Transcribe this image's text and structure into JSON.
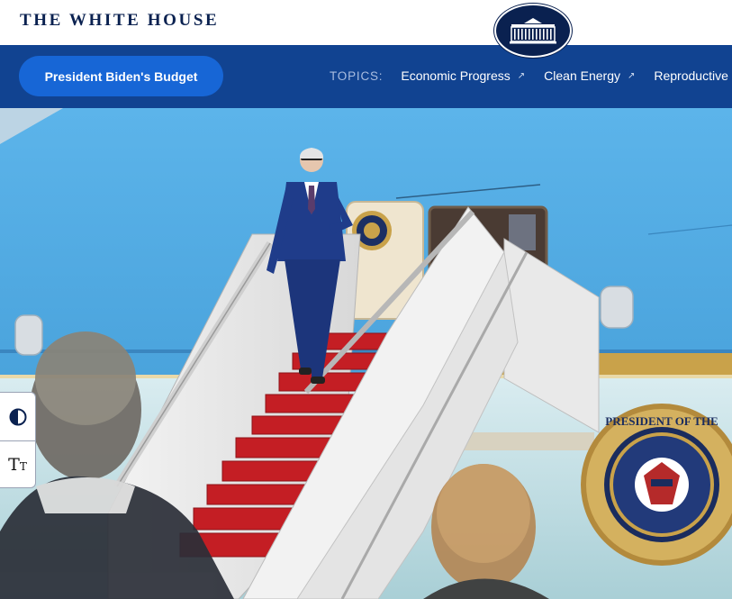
{
  "header": {
    "site_title": "THE WHITE HOUSE",
    "logo_icon": "white-house-seal-icon"
  },
  "nav": {
    "budget_button": "President Biden's Budget",
    "topics_label": "TOPICS:",
    "topics": [
      {
        "label": "Economic Progress",
        "icon": "external-arrow-icon"
      },
      {
        "label": "Clean Energy",
        "icon": "external-arrow-icon"
      },
      {
        "label": "Reproductive F",
        "icon": "external-arrow-icon"
      }
    ]
  },
  "hero": {
    "seal_text": "SEAL OF THE PRESIDENT OF THE UNITED STATES"
  },
  "accessibility": {
    "contrast_icon": "contrast-icon",
    "text_size_icon": "text-size-icon"
  },
  "colors": {
    "navy": "#0a2150",
    "nav_blue": "#114391",
    "button_blue": "#1766d6",
    "sky_blue": "#5fb0e6",
    "red_carpet": "#c41e24",
    "gold": "#c9a24a"
  }
}
